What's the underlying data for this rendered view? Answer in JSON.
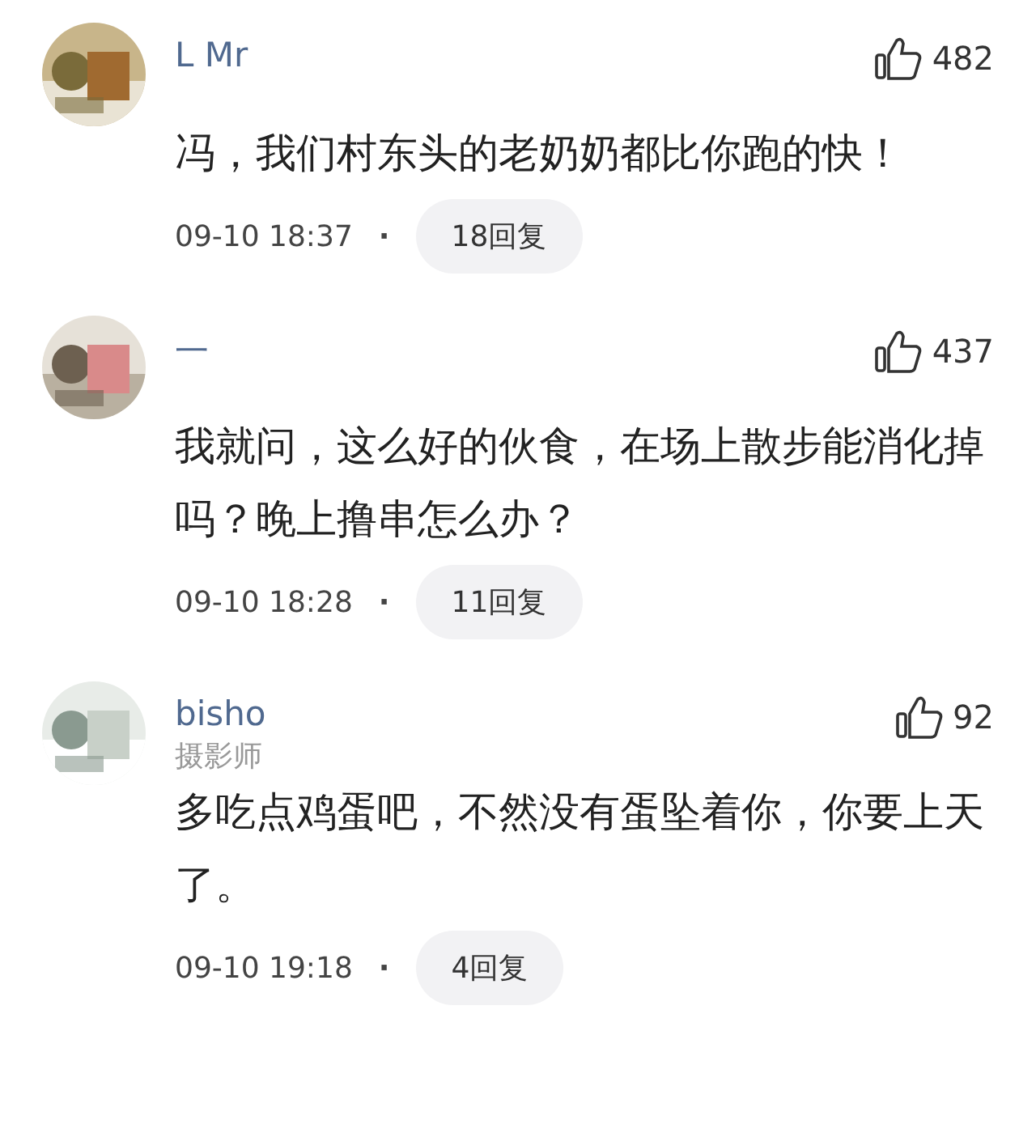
{
  "comments": [
    {
      "username": "L Mr",
      "likes": "482",
      "text": "冯，我们村东头的老奶奶都比你跑的快！",
      "time": "09-10 18:37",
      "separator": "·",
      "replies": "18回复"
    },
    {
      "username": "一",
      "likes": "437",
      "text": "我就问，这么好的伙食，在场上散步能消化掉吗？晚上撸串怎么办？",
      "time": "09-10 18:28",
      "separator": "·",
      "replies": "11回复"
    },
    {
      "username": "bisho",
      "badge": "摄影师",
      "likes": "92",
      "text": "多吃点鸡蛋吧，不然没有蛋坠着你，你要上天了。",
      "time": "09-10 19:18",
      "separator": "·",
      "replies": "4回复"
    }
  ]
}
